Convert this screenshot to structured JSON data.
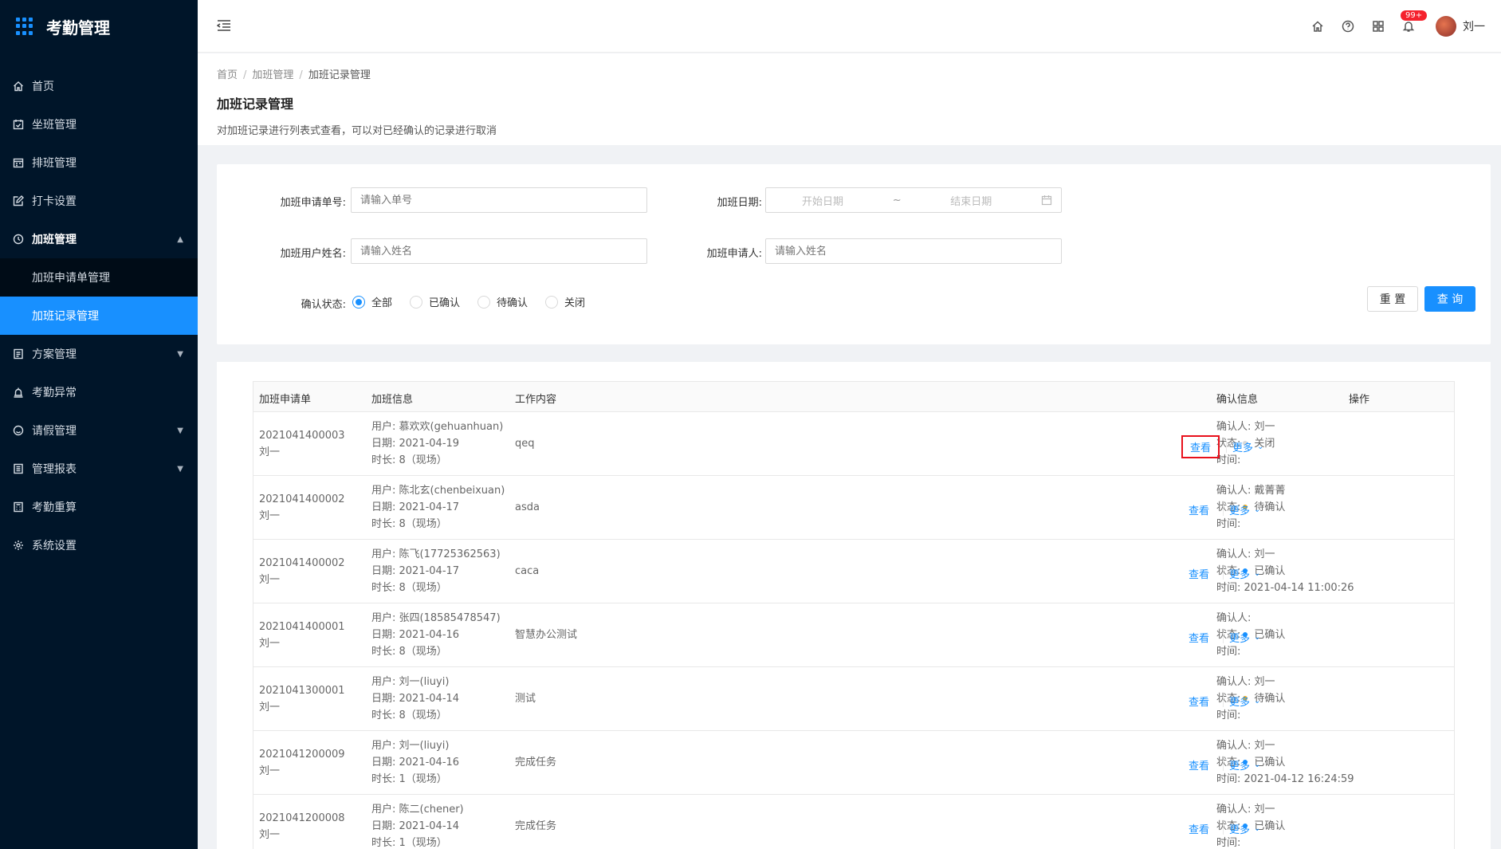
{
  "app": {
    "title": "考勤管理"
  },
  "sidebar": {
    "items": [
      {
        "label": "首页",
        "icon": "home-icon"
      },
      {
        "label": "坐班管理",
        "icon": "calendar-check-icon"
      },
      {
        "label": "排班管理",
        "icon": "schedule-icon"
      },
      {
        "label": "打卡设置",
        "icon": "edit-icon"
      },
      {
        "label": "加班管理",
        "icon": "clock-icon",
        "open": true,
        "children": [
          {
            "label": "加班申请单管理"
          },
          {
            "label": "加班记录管理",
            "active": true
          }
        ]
      },
      {
        "label": "方案管理",
        "icon": "document-icon",
        "arrow": "down"
      },
      {
        "label": "考勤异常",
        "icon": "alarm-icon"
      },
      {
        "label": "请假管理",
        "icon": "leave-icon",
        "arrow": "down"
      },
      {
        "label": "管理报表",
        "icon": "report-icon",
        "arrow": "down"
      },
      {
        "label": "考勤重算",
        "icon": "calculator-icon"
      },
      {
        "label": "系统设置",
        "icon": "settings-icon"
      }
    ]
  },
  "topbar": {
    "notification_badge": "99+",
    "username": "刘一"
  },
  "breadcrumb": {
    "items": [
      "首页",
      "加班管理",
      "加班记录管理"
    ]
  },
  "page": {
    "title": "加班记录管理",
    "description": "对加班记录进行列表式查看，可以对已经确认的记录进行取消"
  },
  "filters": {
    "order_no_label": "加班申请单号:",
    "order_no_placeholder": "请输入单号",
    "date_label": "加班日期:",
    "date_start_placeholder": "开始日期",
    "date_sep": "~",
    "date_end_placeholder": "结束日期",
    "user_name_label": "加班用户姓名:",
    "user_name_placeholder": "请输入姓名",
    "applicant_label": "加班申请人:",
    "applicant_placeholder": "请输入姓名",
    "status_label": "确认状态:",
    "status_options": [
      "全部",
      "已确认",
      "待确认",
      "关闭"
    ],
    "status_selected": "全部",
    "reset_label": "重 置",
    "query_label": "查 询"
  },
  "table": {
    "headers": [
      "加班申请单",
      "加班信息",
      "工作内容",
      "确认信息",
      "操作"
    ],
    "view_label": "查看",
    "more_label": "更多",
    "rows": [
      {
        "id": "2021041400003",
        "applicant": "刘一",
        "user": "用户: 慕欢欢(gehuanhuan)",
        "date": "日期: 2021-04-19",
        "duration": "时长: 8（现场）",
        "work": "qeq",
        "confirmer": "确认人: 刘一",
        "status_prefix": "状态:",
        "status": "关闭",
        "status_color": "#d9d9d9",
        "time": "时间:",
        "highlight": true
      },
      {
        "id": "2021041400002",
        "applicant": "刘一",
        "user": "用户: 陈北玄(chenbeixuan)",
        "date": "日期: 2021-04-17",
        "duration": "时长: 8（现场）",
        "work": "asda",
        "confirmer": "确认人: 戴菁菁",
        "status_prefix": "状态:",
        "status": "待确认",
        "status_color": "#faad14",
        "time": "时间:"
      },
      {
        "id": "2021041400002",
        "applicant": "刘一",
        "user": "用户: 陈飞(17725362563)",
        "date": "日期: 2021-04-17",
        "duration": "时长: 8（现场）",
        "work": "caca",
        "confirmer": "确认人: 刘一",
        "status_prefix": "状态:",
        "status": "已确认",
        "status_color": "#1890ff",
        "time": "时间: 2021-04-14 11:00:26"
      },
      {
        "id": "2021041400001",
        "applicant": "刘一",
        "user": "用户: 张四(18585478547)",
        "date": "日期: 2021-04-16",
        "duration": "时长: 8（现场）",
        "work": "智慧办公测试",
        "confirmer": "确认人:",
        "status_prefix": "状态:",
        "status": "已确认",
        "status_color": "#1890ff",
        "time": "时间:"
      },
      {
        "id": "2021041300001",
        "applicant": "刘一",
        "user": "用户: 刘一(liuyi)",
        "date": "日期: 2021-04-14",
        "duration": "时长: 8（现场）",
        "work": "测试",
        "confirmer": "确认人: 刘一",
        "status_prefix": "状态:",
        "status": "待确认",
        "status_color": "#faad14",
        "time": "时间:"
      },
      {
        "id": "2021041200009",
        "applicant": "刘一",
        "user": "用户: 刘一(liuyi)",
        "date": "日期: 2021-04-16",
        "duration": "时长: 1（现场）",
        "work": "完成任务",
        "confirmer": "确认人: 刘一",
        "status_prefix": "状态:",
        "status": "已确认",
        "status_color": "#1890ff",
        "time": "时间: 2021-04-12 16:24:59"
      },
      {
        "id": "2021041200008",
        "applicant": "刘一",
        "user": "用户: 陈二(chener)",
        "date": "日期: 2021-04-14",
        "duration": "时长: 1（现场）",
        "work": "完成任务",
        "confirmer": "确认人: 刘一",
        "status_prefix": "状态:",
        "status": "已确认",
        "status_color": "#1890ff",
        "time": "时间:"
      }
    ]
  }
}
